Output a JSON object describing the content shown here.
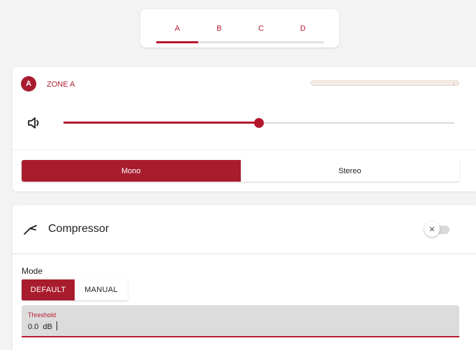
{
  "tabs": {
    "items": [
      {
        "label": "A",
        "active": true
      },
      {
        "label": "B",
        "active": false
      },
      {
        "label": "C",
        "active": false
      },
      {
        "label": "D",
        "active": false
      }
    ]
  },
  "zone": {
    "badge": "A",
    "title": "ZONE A",
    "volume_fraction": 0.5,
    "volume_icon": "speaker-icon",
    "output_modes": [
      {
        "label": "Mono",
        "active": true
      },
      {
        "label": "Stereo",
        "active": false
      }
    ]
  },
  "compressor": {
    "icon": "compressor-icon",
    "title": "Compressor",
    "enabled": false,
    "toggle_glyph": "✕",
    "mode_label": "Mode",
    "modes": [
      {
        "label": "DEFAULT",
        "active": true
      },
      {
        "label": "MANUAL",
        "active": false
      }
    ],
    "threshold": {
      "label": "Threshold",
      "value": "0.0  dB"
    }
  },
  "colors": {
    "accent": "#b3182f",
    "accent_dark": "#a81c2e",
    "background": "#f3f3f3",
    "field_bg": "#dcdcdc"
  }
}
